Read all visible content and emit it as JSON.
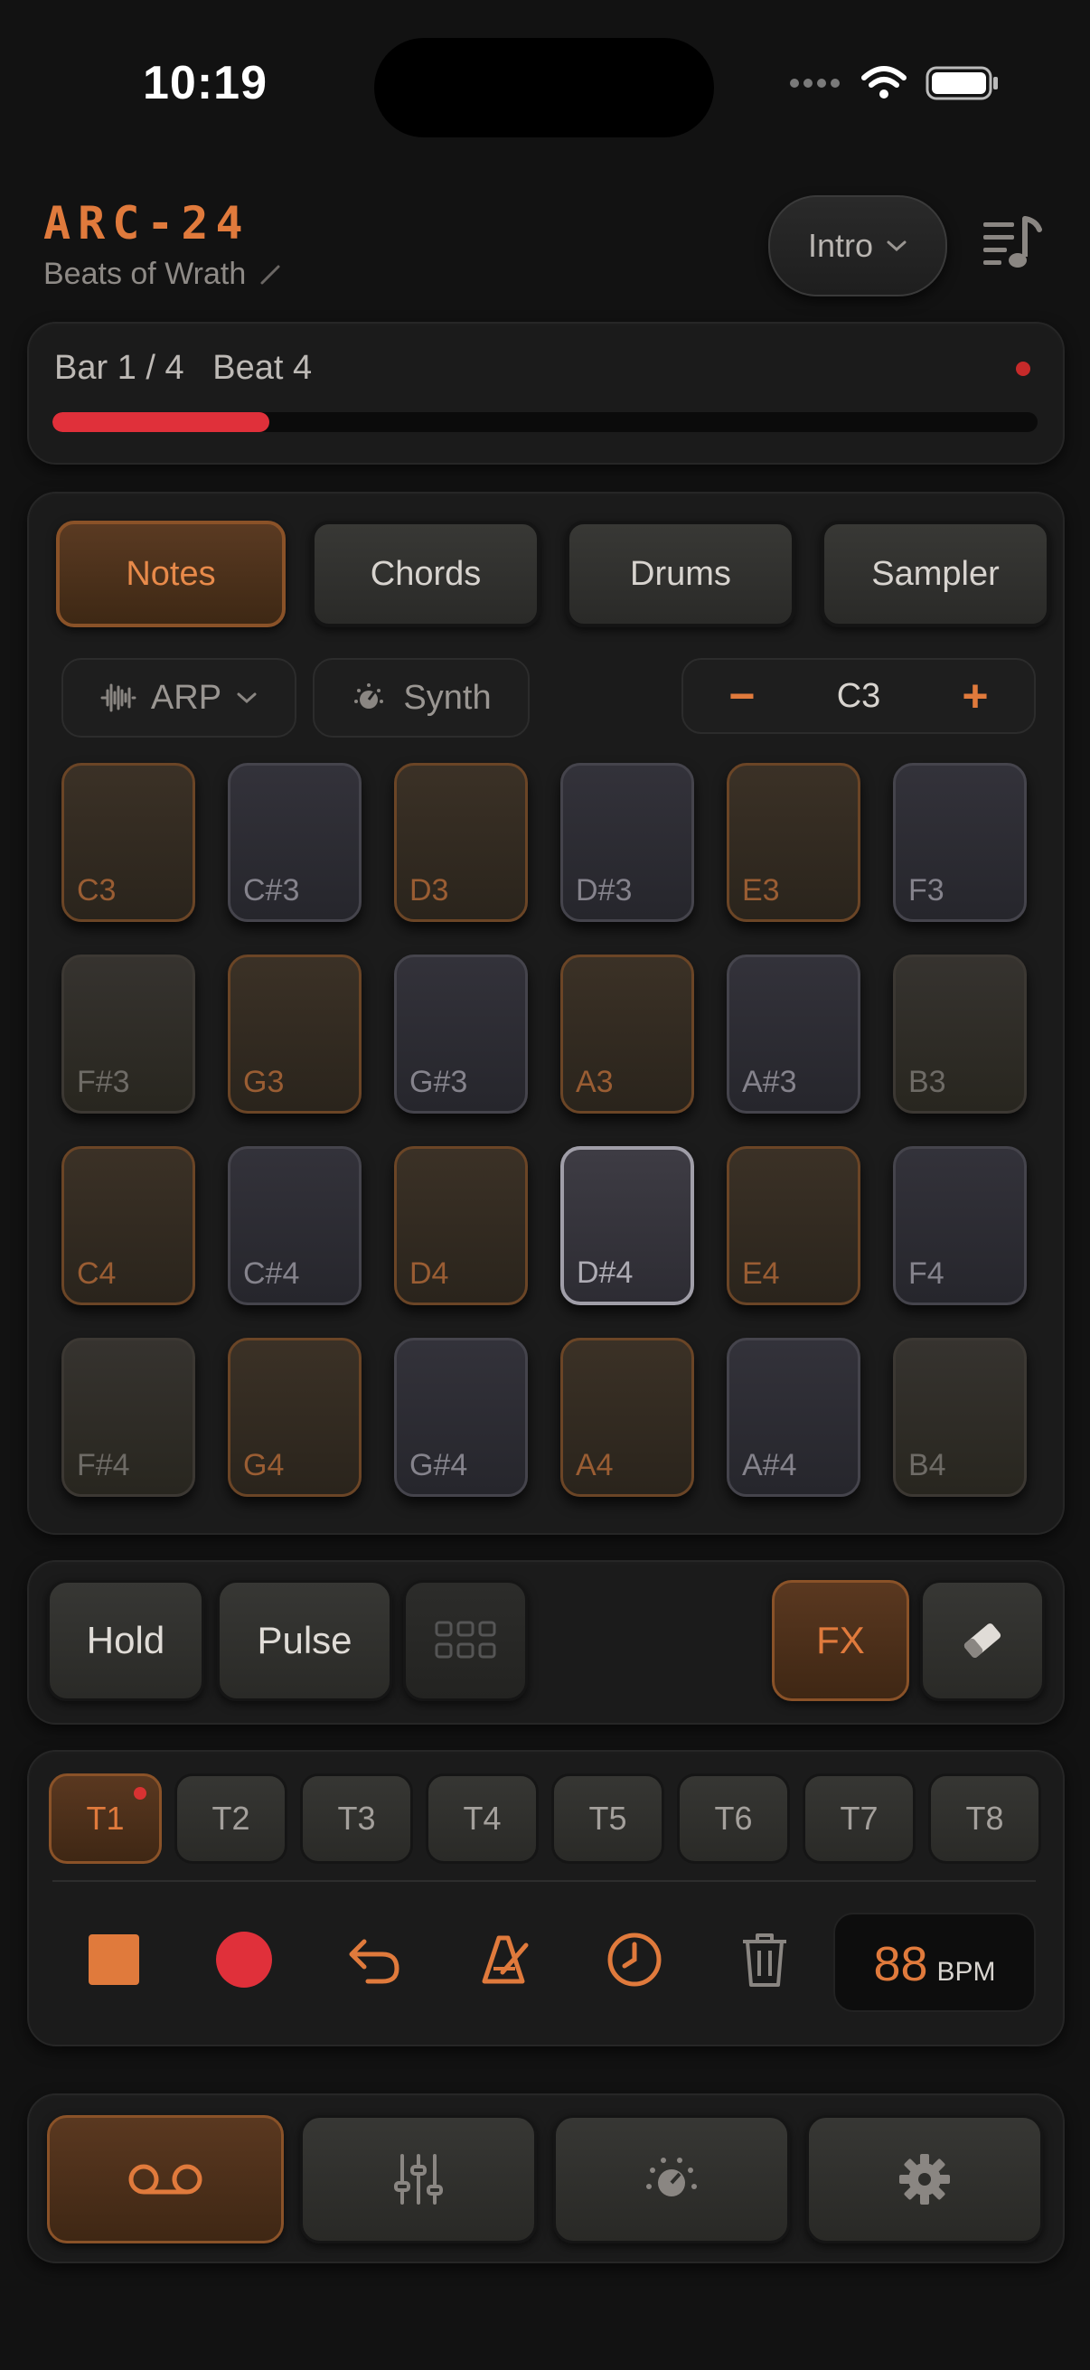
{
  "status_bar": {
    "time": "10:19"
  },
  "header": {
    "app_title": "ARC-24",
    "song_name": "Beats of Wrath",
    "section_label": "Intro"
  },
  "progress": {
    "position_label": "Bar 1 / 4   Beat 4",
    "progress_fraction": 0.22
  },
  "modes": [
    {
      "label": "Notes",
      "active": true
    },
    {
      "label": "Chords",
      "active": false
    },
    {
      "label": "Drums",
      "active": false
    },
    {
      "label": "Sampler",
      "active": false
    }
  ],
  "controls": {
    "arp_label": "ARP",
    "synth_label": "Synth",
    "octave": {
      "minus": "−",
      "value": "C3",
      "plus": "+"
    }
  },
  "pads": [
    {
      "note": "C3",
      "kind": "white"
    },
    {
      "note": "C#3",
      "kind": "black"
    },
    {
      "note": "D3",
      "kind": "white"
    },
    {
      "note": "D#3",
      "kind": "black"
    },
    {
      "note": "E3",
      "kind": "white"
    },
    {
      "note": "F3",
      "kind": "black"
    },
    {
      "note": "F#3",
      "kind": "plain"
    },
    {
      "note": "G3",
      "kind": "white"
    },
    {
      "note": "G#3",
      "kind": "black"
    },
    {
      "note": "A3",
      "kind": "white"
    },
    {
      "note": "A#3",
      "kind": "black"
    },
    {
      "note": "B3",
      "kind": "plain"
    },
    {
      "note": "C4",
      "kind": "white"
    },
    {
      "note": "C#4",
      "kind": "black"
    },
    {
      "note": "D4",
      "kind": "white"
    },
    {
      "note": "D#4",
      "kind": "sel"
    },
    {
      "note": "E4",
      "kind": "white"
    },
    {
      "note": "F4",
      "kind": "black"
    },
    {
      "note": "F#4",
      "kind": "plain"
    },
    {
      "note": "G4",
      "kind": "white"
    },
    {
      "note": "G#4",
      "kind": "black"
    },
    {
      "note": "A4",
      "kind": "white"
    },
    {
      "note": "A#4",
      "kind": "black"
    },
    {
      "note": "B4",
      "kind": "plain"
    }
  ],
  "performance": {
    "hold_label": "Hold",
    "pulse_label": "Pulse",
    "fx_label": "FX"
  },
  "tracks": [
    {
      "label": "T1",
      "active": true
    },
    {
      "label": "T2",
      "active": false
    },
    {
      "label": "T3",
      "active": false
    },
    {
      "label": "T4",
      "active": false
    },
    {
      "label": "T5",
      "active": false
    },
    {
      "label": "T6",
      "active": false
    },
    {
      "label": "T7",
      "active": false
    },
    {
      "label": "T8",
      "active": false
    }
  ],
  "transport": {
    "bpm_value": "88",
    "bpm_unit": "BPM"
  },
  "colors": {
    "accent": "#e07a3c",
    "record": "#e0303a",
    "background": "#121212"
  },
  "icons": [
    "wifi-icon",
    "battery-icon",
    "signal-icon",
    "playlist-icon",
    "waveform-icon",
    "knob-icon",
    "grid-icon",
    "eraser-icon",
    "stop-icon",
    "record-icon",
    "undo-icon",
    "metronome-icon",
    "clock-icon",
    "trash-icon",
    "tape-icon",
    "mixer-icon",
    "dial-icon",
    "gear-icon"
  ]
}
